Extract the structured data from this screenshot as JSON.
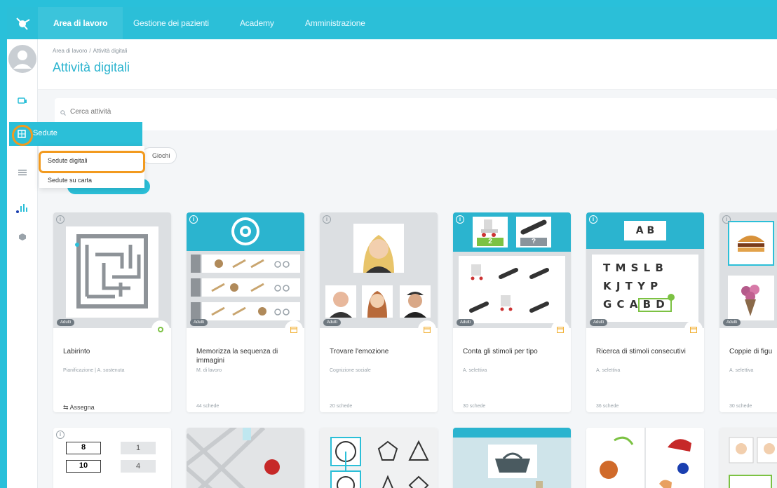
{
  "nav": {
    "tabs": [
      {
        "label": "Area di lavoro",
        "active": true
      },
      {
        "label": "Gestione dei pazienti",
        "active": false
      },
      {
        "label": "Academy",
        "active": false
      },
      {
        "label": "Amministrazione",
        "active": false
      }
    ]
  },
  "breadcrumb": {
    "root": "Area di lavoro",
    "separator": "/",
    "current": "Attività digitali"
  },
  "page_title": "Attività digitali",
  "search": {
    "placeholder": "Cerca attività"
  },
  "filter_chip": "Giochi",
  "menu": {
    "active_item": "Sedute",
    "submenu": [
      "Sedute digitali",
      "Sedute su carta"
    ]
  },
  "cards": [
    {
      "badge": "Adulti",
      "title": "Labirinto",
      "subtitle": "Pianificazione | A. sostenuta",
      "footer": "Assegna"
    },
    {
      "badge": "Adulti",
      "title": "Memorizza la sequenza di immagini",
      "subtitle": "M. di lavoro",
      "footer": "44 schede"
    },
    {
      "badge": "Adulti",
      "title": "Trovare l'emozione",
      "subtitle": "Cognizione sociale",
      "footer": "20 schede"
    },
    {
      "badge": "Adulti",
      "title": "Conta gli stimoli per tipo",
      "subtitle": "A. selettiva",
      "footer": "30 schede"
    },
    {
      "badge": "Adulti",
      "title": "Ricerca di stimoli consecutivi",
      "subtitle": "A. selettiva",
      "footer": "36 schede"
    },
    {
      "badge": "Adulti",
      "title": "Coppie di figu",
      "subtitle": "A. selettiva",
      "footer": "30 schede"
    }
  ],
  "card5_thumb": {
    "top": "A B",
    "rows": [
      "T M S L B",
      "K J T Y P",
      "G C A B D"
    ]
  },
  "card4_thumb": {
    "counter_a": "2",
    "counter_b": "?"
  },
  "row2": {
    "numbers_left": [
      "8",
      "10"
    ],
    "numbers_right": [
      "1",
      "4"
    ]
  },
  "colors": {
    "accent": "#2bbfd8",
    "highlight": "#f29a1f",
    "title": "#2bb4cf"
  }
}
